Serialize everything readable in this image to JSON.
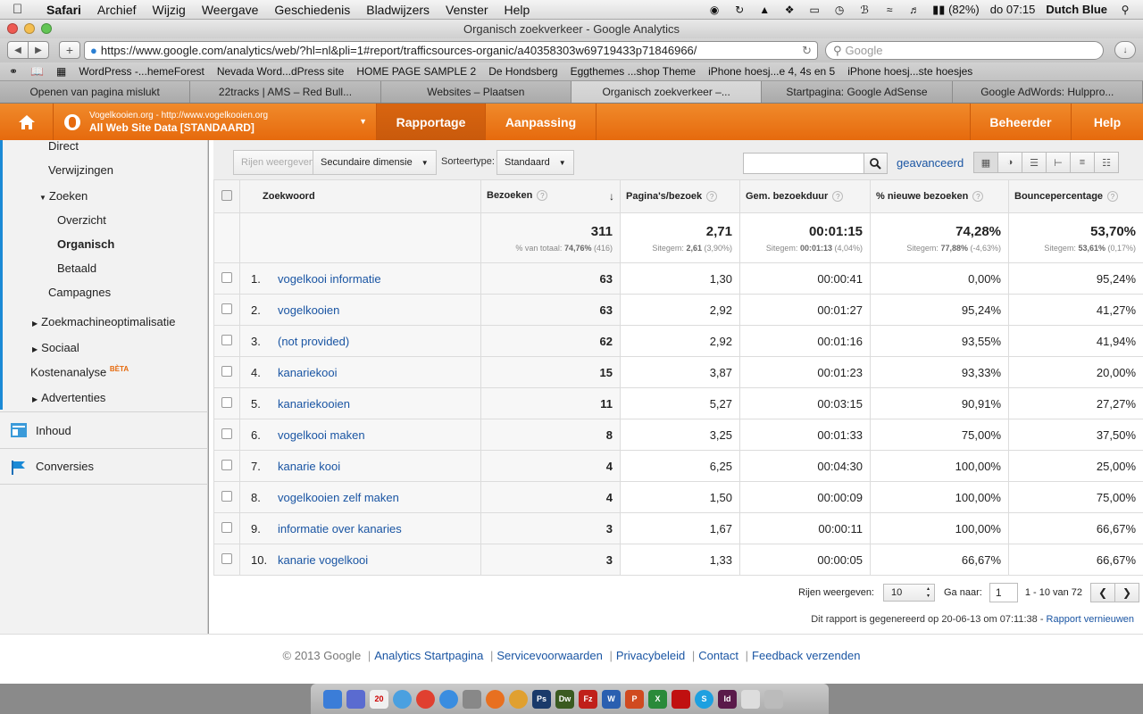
{
  "menubar": {
    "apple": "",
    "app": "Safari",
    "items": [
      "Archief",
      "Wijzig",
      "Weergave",
      "Geschiedenis",
      "Bladwijzers",
      "Venster",
      "Help"
    ],
    "battery": "(82%)",
    "clock": "do 07:15",
    "user": "Dutch Blue"
  },
  "window": {
    "title": "Organisch zoekverkeer - Google Analytics",
    "url": "https://www.google.com/analytics/web/?hl=nl&pli=1#report/trafficsources-organic/a40358303w69719433p71846966/",
    "search_placeholder": "Google"
  },
  "bookmarks": [
    "WordPress -...hemeForest",
    "Nevada Word...dPress site",
    "HOME PAGE SAMPLE 2",
    "De Hondsberg",
    "Eggthemes ...shop Theme",
    "iPhone hoesj...e 4, 4s en 5",
    "iPhone hoesj...ste hoesjes"
  ],
  "tabs": [
    "Openen van pagina mislukt",
    "22tracks | AMS – Red Bull...",
    "Websites – Plaatsen",
    "Organisch zoekverkeer –...",
    "Startpagina: Google AdSense",
    "Google AdWords: Hulppro..."
  ],
  "ga_nav": {
    "site": "Vogelkooien.org - http://www.vogelkooien.org",
    "account": "All Web Site Data [STANDAARD]",
    "tab_report": "Rapportage",
    "tab_custom": "Aanpassing",
    "admin": "Beheerder",
    "help": "Help"
  },
  "sidebar": {
    "direct": "Direct",
    "referrals": "Verwijzingen",
    "search": "Zoeken",
    "overview": "Overzicht",
    "organic": "Organisch",
    "paid": "Betaald",
    "campaigns": "Campagnes",
    "seo": "Zoekmachineoptimalisatie",
    "social": "Sociaal",
    "cost": "Kostenanalyse",
    "beta": "BÈTA",
    "ads": "Advertenties",
    "content": "Inhoud",
    "conversions": "Conversies"
  },
  "toolbar": {
    "plot_rows": "Rijen weergeven",
    "secondary_dim": "Secundaire dimensie",
    "sort_label": "Sorteertype:",
    "sort_value": "Standaard",
    "advanced": "geavanceerd"
  },
  "table": {
    "headers": {
      "keyword": "Zoekwoord",
      "visits": "Bezoeken",
      "pages": "Pagina's/bezoek",
      "duration": "Gem. bezoekduur",
      "new": "% nieuwe bezoeken",
      "bounce": "Bouncepercentage"
    },
    "totals": {
      "visits": "311",
      "visits_sub_label": "% van totaal:",
      "visits_sub_value": "74,76%",
      "visits_sub_extra": "(416)",
      "pages": "2,71",
      "pages_sub_label": "Sitegem:",
      "pages_sub_value": "2,61",
      "pages_sub_extra": "(3,90%)",
      "duration": "00:01:15",
      "duration_sub_label": "Sitegem:",
      "duration_sub_value": "00:01:13",
      "duration_sub_extra": "(4,04%)",
      "new": "74,28%",
      "new_sub_label": "Sitegem:",
      "new_sub_value": "77,88%",
      "new_sub_extra": "(-4,63%)",
      "bounce": "53,70%",
      "bounce_sub_label": "Sitegem:",
      "bounce_sub_value": "53,61%",
      "bounce_sub_extra": "(0,17%)"
    },
    "rows": [
      {
        "n": "1.",
        "kw": "vogelkooi informatie",
        "visits": "63",
        "pages": "1,30",
        "duration": "00:00:41",
        "new": "0,00%",
        "bounce": "95,24%"
      },
      {
        "n": "2.",
        "kw": "vogelkooien",
        "visits": "63",
        "pages": "2,92",
        "duration": "00:01:27",
        "new": "95,24%",
        "bounce": "41,27%"
      },
      {
        "n": "3.",
        "kw": "(not provided)",
        "visits": "62",
        "pages": "2,92",
        "duration": "00:01:16",
        "new": "93,55%",
        "bounce": "41,94%"
      },
      {
        "n": "4.",
        "kw": "kanariekooi",
        "visits": "15",
        "pages": "3,87",
        "duration": "00:01:23",
        "new": "93,33%",
        "bounce": "20,00%"
      },
      {
        "n": "5.",
        "kw": "kanariekooien",
        "visits": "11",
        "pages": "5,27",
        "duration": "00:03:15",
        "new": "90,91%",
        "bounce": "27,27%"
      },
      {
        "n": "6.",
        "kw": "vogelkooi maken",
        "visits": "8",
        "pages": "3,25",
        "duration": "00:01:33",
        "new": "75,00%",
        "bounce": "37,50%"
      },
      {
        "n": "7.",
        "kw": "kanarie kooi",
        "visits": "4",
        "pages": "6,25",
        "duration": "00:04:30",
        "new": "100,00%",
        "bounce": "25,00%"
      },
      {
        "n": "8.",
        "kw": "vogelkooien zelf maken",
        "visits": "4",
        "pages": "1,50",
        "duration": "00:00:09",
        "new": "100,00%",
        "bounce": "75,00%"
      },
      {
        "n": "9.",
        "kw": "informatie over kanaries",
        "visits": "3",
        "pages": "1,67",
        "duration": "00:00:11",
        "new": "100,00%",
        "bounce": "66,67%"
      },
      {
        "n": "10.",
        "kw": "kanarie vogelkooi",
        "visits": "3",
        "pages": "1,33",
        "duration": "00:00:05",
        "new": "66,67%",
        "bounce": "66,67%"
      }
    ]
  },
  "pager": {
    "rows_label": "Rijen weergeven:",
    "rows_value": "10",
    "goto_label": "Ga naar:",
    "goto_value": "1",
    "range": "1 - 10 van 72"
  },
  "generated": {
    "text": "Dit rapport is gegenereerd op 20-06-13 om 07:11:38 -",
    "refresh": "Rapport vernieuwen"
  },
  "footer": {
    "copyright": "© 2013 Google",
    "links": [
      "Analytics Startpagina",
      "Servicevoorwaarden",
      "Privacybeleid",
      "Contact",
      "Feedback verzenden"
    ]
  },
  "colors": {
    "ga_orange": "#e66a0d",
    "link_blue": "#1a55a3",
    "accent_blue": "#1b8ad6"
  },
  "icons": [
    "apple-icon",
    "home-icon",
    "globe-icon",
    "search-icon",
    "table-view-icon",
    "pie-view-icon",
    "bar-view-icon",
    "compare-view-icon",
    "pivot-view-icon",
    "sparkline-view-icon",
    "checkbox-icon",
    "sort-desc-icon",
    "help-icon"
  ]
}
